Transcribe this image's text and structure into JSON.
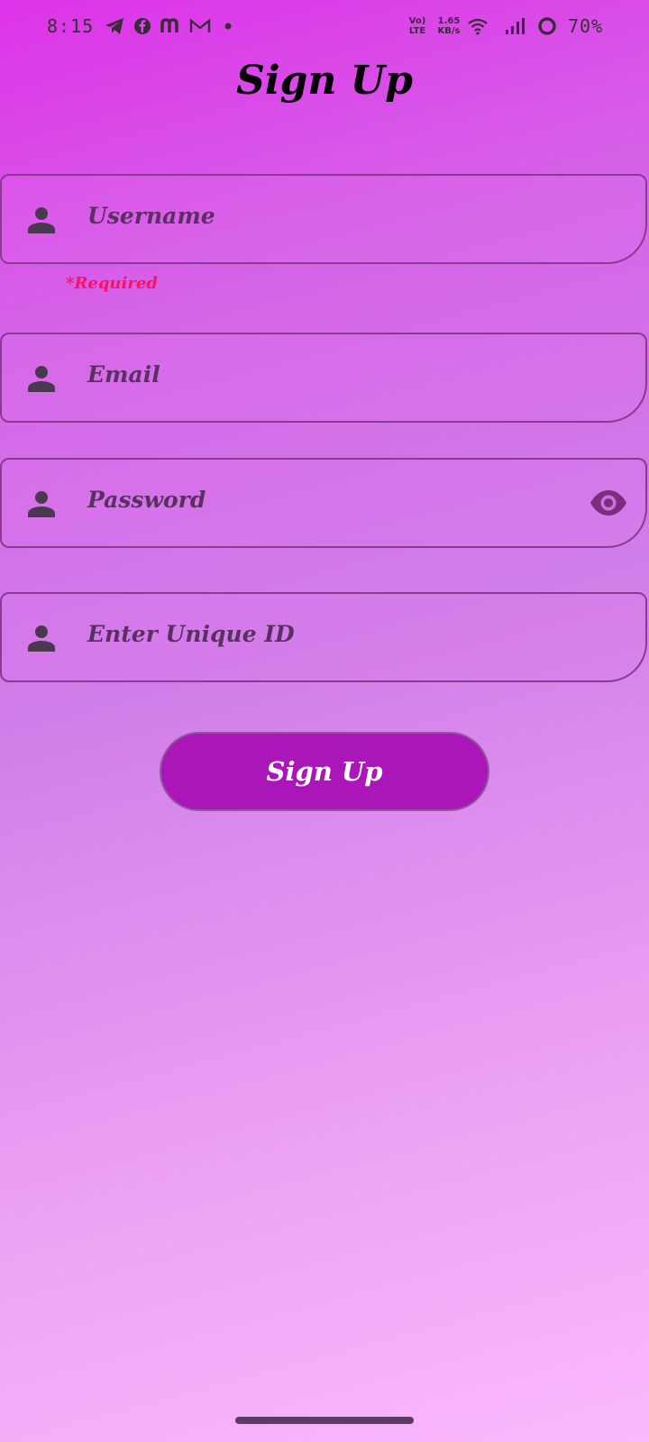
{
  "status_bar": {
    "time": "8:15",
    "notification_icons": [
      "telegram-icon",
      "facebook-icon",
      "m-app-icon",
      "gmail-icon",
      "dot-icon"
    ],
    "volte_top": "Vo)",
    "volte_bottom": "LTE",
    "speed_value": "1.65",
    "speed_unit": "KB/s",
    "battery": "70%"
  },
  "page": {
    "title": "Sign Up"
  },
  "form": {
    "username": {
      "placeholder": "Username",
      "icon": "person-icon"
    },
    "username_error": "*Required",
    "email": {
      "placeholder": "Email",
      "icon": "person-icon"
    },
    "password": {
      "placeholder": "Password",
      "icon": "person-icon",
      "toggle_icon": "eye-icon"
    },
    "unique_id": {
      "placeholder": "Enter Unique ID",
      "icon": "person-icon"
    },
    "submit_label": "Sign Up"
  },
  "colors": {
    "button_bg": "#aa16b8",
    "error_text": "#ff1060",
    "field_border": "#8a3a90"
  }
}
